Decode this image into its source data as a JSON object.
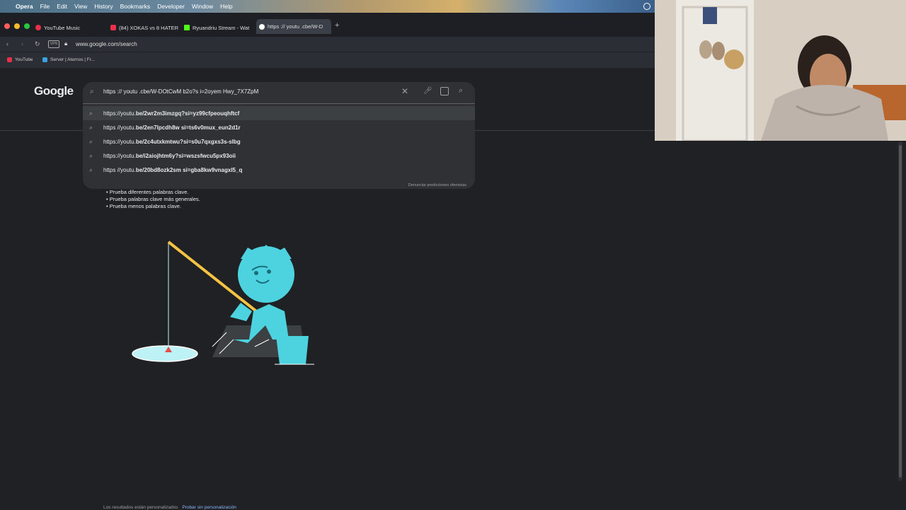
{
  "menubar": {
    "app": "Opera",
    "items": [
      "File",
      "Edit",
      "View",
      "History",
      "Bookmarks",
      "Developer",
      "Window",
      "Help"
    ]
  },
  "tabs": [
    {
      "label": "YouTube Music",
      "color": "#e8304a"
    },
    {
      "label": "(84) XOKAS vs 8 HATER",
      "color": "#e8304a"
    },
    {
      "label": "Ryuandriu Stream - Wat",
      "color": "#53fc18"
    },
    {
      "label": "https :// youtu .cbe/W-D",
      "color": "#8ab4f8"
    }
  ],
  "address": {
    "url": "www.google.com/search",
    "vpn": "VPN"
  },
  "bookmarks": [
    {
      "label": "YouTube",
      "color": "#e8304a"
    },
    {
      "label": "Server | Aternos | Fr...",
      "color": "#3aa0e0"
    }
  ],
  "google": {
    "logo": "Google",
    "query": "https :// youtu .cbe/W-DOtCwM b2o?s i=2oyem Hwy_7X7ZpM",
    "suggestions": [
      {
        "prefix": "https://youtu.",
        "bold": "be/2wr2m3imzgq?si=yz99cfpeouqhftcf"
      },
      {
        "prefix": "https //youtu.",
        "bold": "be/2en7lpcdh8w si=ts6v0mux_eun2d1r"
      },
      {
        "prefix": "https://youtu.",
        "bold": "be/2c4utxkmtwu?si=s0u7qxgxs3s-slbg"
      },
      {
        "prefix": "https://youtu.",
        "bold": "be/i2aiojhtm6y?si=wszsfwcu5px93oii"
      },
      {
        "prefix": "https //youtu.",
        "bold": "be/20bd8ozk2sm si=gba8kw9vnagxl5_q"
      }
    ],
    "report": "Denunciar predicciones ofensivas",
    "tips": [
      "Prueba diferentes palabras clave.",
      "Prueba palabras clave más generales.",
      "Prueba menos palabras clave."
    ],
    "footer_text": "Los resultados están personalizados",
    "footer_link": "Probar sin personalización"
  },
  "colors": {
    "accent": "#8ab4f8",
    "fish_monster": "#4dd3e0",
    "rod": "#f6c343"
  }
}
